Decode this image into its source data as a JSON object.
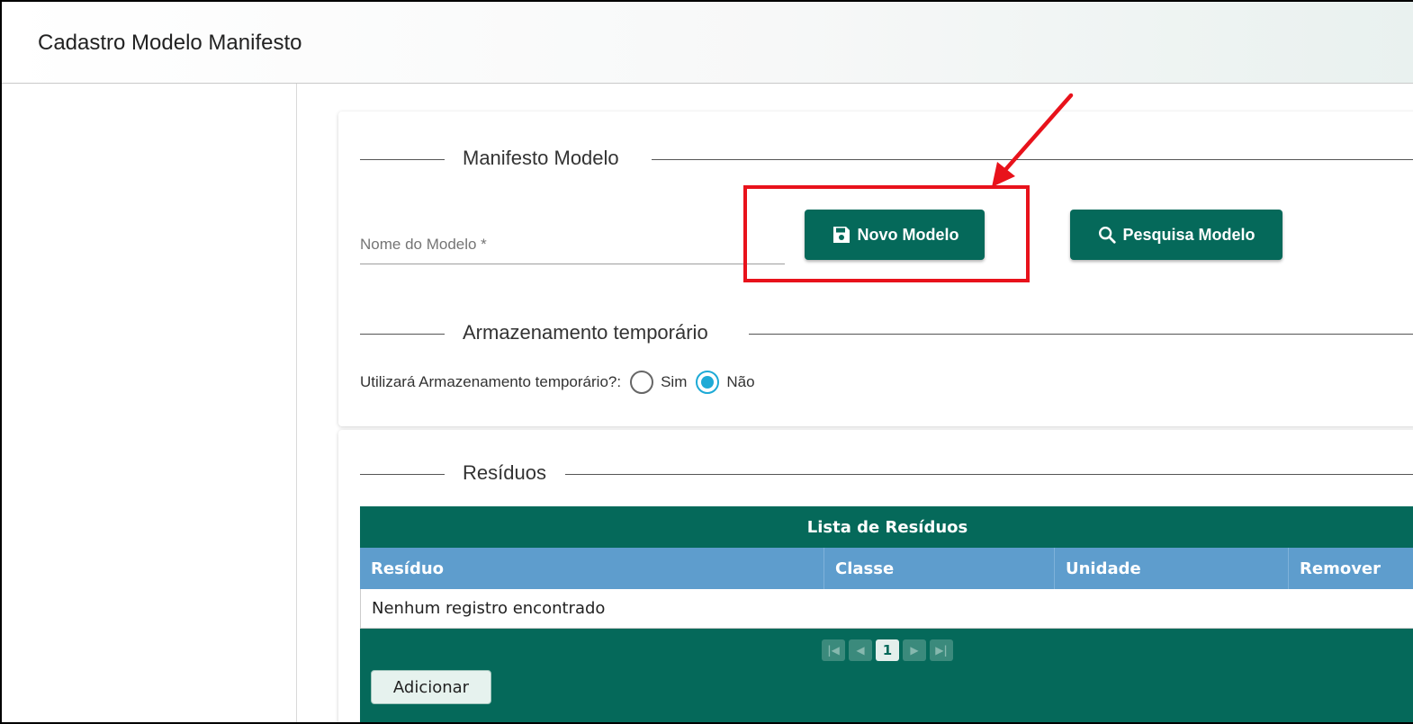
{
  "header": {
    "title": "Cadastro Modelo Manifesto"
  },
  "manifesto": {
    "section_title": "Manifesto Modelo",
    "name_field": {
      "label": "Nome do Modelo *",
      "value": ""
    },
    "novo_button": {
      "label": "Novo Modelo",
      "icon": "save-icon"
    },
    "pesquisa_button": {
      "label": "Pesquisa Modelo",
      "icon": "search-icon"
    }
  },
  "armazenamento": {
    "section_title": "Armazenamento temporário",
    "question": "Utilizará Armazenamento temporário?:",
    "options": [
      {
        "label": "Sim",
        "checked": false
      },
      {
        "label": "Não",
        "checked": true
      }
    ]
  },
  "residuos": {
    "section_title": "Resíduos",
    "table": {
      "caption": "Lista de Resíduos",
      "columns": [
        "Resíduo",
        "Classe",
        "Unidade",
        "Remover"
      ],
      "empty_message": "Nenhum registro encontrado",
      "pagination": {
        "current_page": "1"
      },
      "add_button": "Adicionar"
    }
  },
  "colors": {
    "primary": "#05695a",
    "table_header": "#5e9dcd",
    "highlight": "#e8121b",
    "radio_checked": "#1eaad6"
  }
}
